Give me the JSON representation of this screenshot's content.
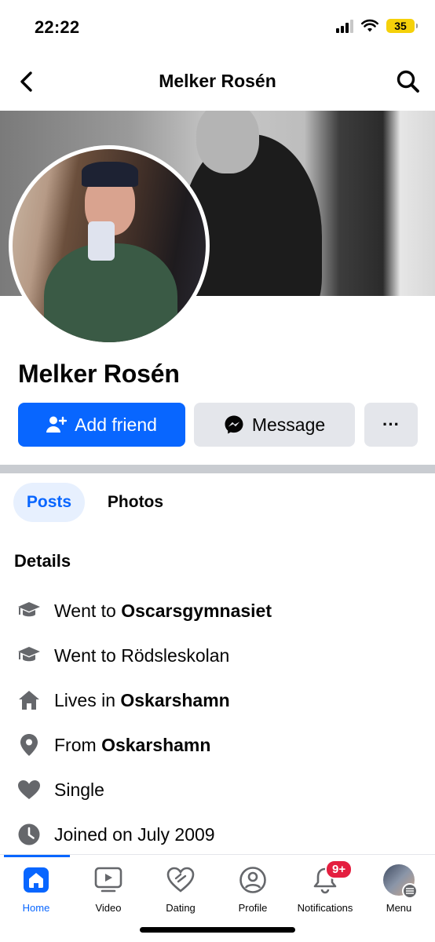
{
  "status_bar": {
    "time": "22:22",
    "battery": "35"
  },
  "header": {
    "title": "Melker Rosén"
  },
  "profile": {
    "name": "Melker Rosén"
  },
  "actions": {
    "add_friend": "Add friend",
    "message": "Message",
    "more": "···"
  },
  "tabs": [
    {
      "label": "Posts",
      "active": true
    },
    {
      "label": "Photos",
      "active": false
    }
  ],
  "details": {
    "title": "Details",
    "items": [
      {
        "icon": "graduation-cap-icon",
        "prefix": "Went to ",
        "bold": "Oscarsgymnasiet"
      },
      {
        "icon": "graduation-cap-icon",
        "prefix": "Went to Rödsleskolan",
        "bold": ""
      },
      {
        "icon": "home-icon",
        "prefix": "Lives in ",
        "bold": "Oskarshamn"
      },
      {
        "icon": "location-pin-icon",
        "prefix": "From ",
        "bold": "Oskarshamn"
      },
      {
        "icon": "heart-icon",
        "prefix": "Single",
        "bold": ""
      },
      {
        "icon": "clock-icon",
        "prefix": "Joined on July 2009",
        "bold": ""
      }
    ]
  },
  "tabbar": {
    "items": [
      {
        "label": "Home",
        "icon": "home-icon",
        "active": true
      },
      {
        "label": "Video",
        "icon": "video-icon"
      },
      {
        "label": "Dating",
        "icon": "dating-heart-icon"
      },
      {
        "label": "Profile",
        "icon": "profile-icon"
      },
      {
        "label": "Notifications",
        "icon": "bell-icon",
        "badge": "9+"
      },
      {
        "label": "Menu",
        "icon": "menu-avatar-icon"
      }
    ]
  },
  "colors": {
    "accent": "#0866ff",
    "button_gray": "#e4e6eb",
    "badge_red": "#e41e3f",
    "battery": "#f5d10a"
  }
}
